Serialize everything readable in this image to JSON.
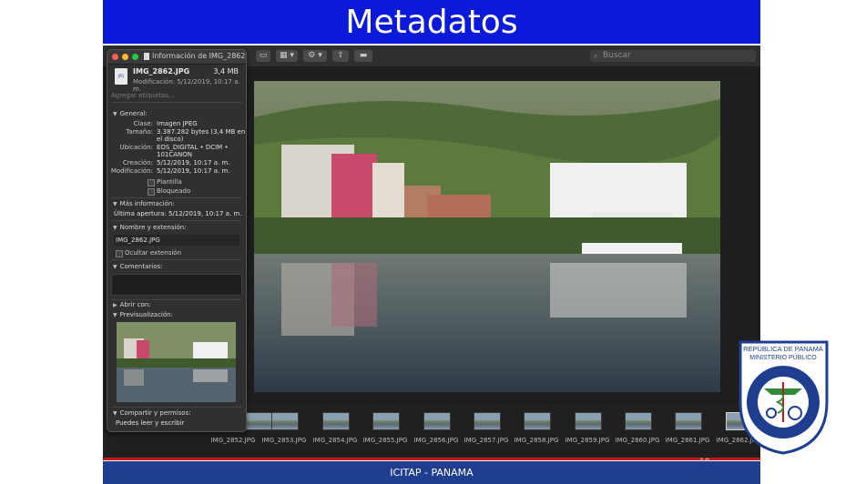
{
  "slide": {
    "title": "Metadatos",
    "footer": "ICITAP - PANAMA",
    "page_number": "10"
  },
  "app": {
    "search_placeholder": "Buscar",
    "filmstrip": [
      "IMG_2852.JPG",
      "IMG_2853.JPG",
      "IMG_2854.JPG",
      "IMG_2855.JPG",
      "IMG_2856.JPG",
      "IMG_2857.JPG",
      "IMG_2858.JPG",
      "IMG_2859.JPG",
      "IMG_2860.JPG",
      "IMG_2861.JPG",
      "IMG_2862.JPG"
    ]
  },
  "info_panel": {
    "window_title": "Información de IMG_2862...",
    "icon_label": "JPG",
    "file_name": "IMG_2862.JPG",
    "file_size": "3,4 MB",
    "modified_summary": "Modificación: 5/12/2019, 10:17 a. m.",
    "tags_placeholder": "Agregar etiquetas...",
    "general": {
      "header": "General:",
      "class_label": "Clase:",
      "class_value": "Imagen JPEG",
      "size_label": "Tamaño:",
      "size_value_1": "3.387.282 bytes (3,4 MB en",
      "size_value_2": "el disco)",
      "location_label": "Ubicación:",
      "location_value_1": "EOS_DIGITAL • DCIM •",
      "location_value_2": "101CANON",
      "created_label": "Creación:",
      "created_value": "5/12/2019, 10:17 a. m.",
      "modified_label": "Modificación:",
      "modified_value": "5/12/2019, 10:17 a. m.",
      "stationery": "Plantilla",
      "locked": "Bloqueado"
    },
    "more_info": {
      "header": "Más información:",
      "last_opened": "Última apertura: 5/12/2019, 10:17 a. m."
    },
    "name_ext": {
      "header": "Nombre y extensión:",
      "value": "IMG_2862.JPG",
      "hide_extension": "Ocultar extensión"
    },
    "comments_header": "Comentarios:",
    "open_with_header": "Abrir con:",
    "preview_header": "Previsualización:",
    "sharing": {
      "header": "Compartir y permisos:",
      "value": "Puedes leer y escribir"
    }
  },
  "logo": {
    "top_line_1": "REPÚBLICA DE PANAMÁ",
    "top_line_2": "MINISTERIO PÚBLICO",
    "ring_text": "INSTITUTO DE MEDICINA LEGAL Y CIENCIAS FORENSES"
  },
  "colors": {
    "title_bar": "#0a1ad8",
    "footer_bar": "#1f3e8f",
    "footer_stripe": "#c7161e"
  }
}
